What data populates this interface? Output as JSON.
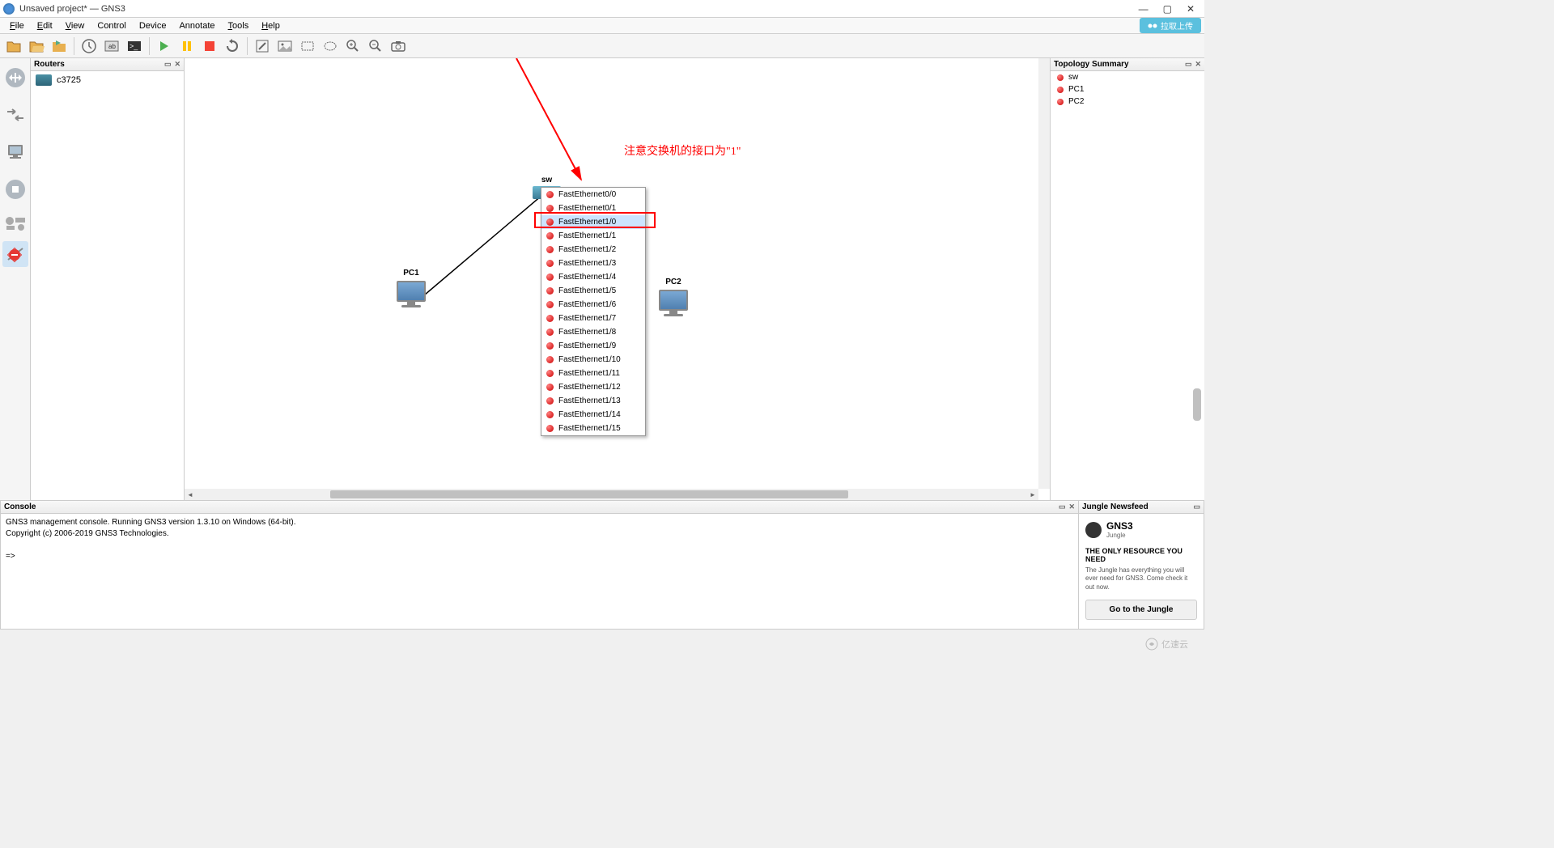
{
  "window": {
    "title": "Unsaved project* — GNS3"
  },
  "menu": {
    "file": "File",
    "edit": "Edit",
    "view": "View",
    "control": "Control",
    "device": "Device",
    "annotate": "Annotate",
    "tools": "Tools",
    "help": "Help",
    "right_badge": "拉取上传"
  },
  "panels": {
    "routers_title": "Routers",
    "routers_items": [
      "c3725"
    ],
    "topo_title": "Topology Summary",
    "topo_items": [
      "sw",
      "PC1",
      "PC2"
    ],
    "console_title": "Console",
    "newsfeed_title": "Jungle Newsfeed"
  },
  "canvas": {
    "sw_label": "sw",
    "pc1_label": "PC1",
    "pc2_label": "PC2",
    "annotation_text": "注意交换机的接口为\"1\""
  },
  "context_menu": {
    "items": [
      "FastEthernet0/0",
      "FastEthernet0/1",
      "FastEthernet1/0",
      "FastEthernet1/1",
      "FastEthernet1/2",
      "FastEthernet1/3",
      "FastEthernet1/4",
      "FastEthernet1/5",
      "FastEthernet1/6",
      "FastEthernet1/7",
      "FastEthernet1/8",
      "FastEthernet1/9",
      "FastEthernet1/10",
      "FastEthernet1/11",
      "FastEthernet1/12",
      "FastEthernet1/13",
      "FastEthernet1/14",
      "FastEthernet1/15"
    ],
    "highlighted_index": 2
  },
  "console": {
    "line1": "GNS3 management console. Running GNS3 version 1.3.10 on Windows (64-bit).",
    "line2": "Copyright (c) 2006-2019 GNS3 Technologies.",
    "prompt": "=>"
  },
  "newsfeed": {
    "logo_text": "GNS3",
    "logo_sub": "Jungle",
    "headline": "THE ONLY RESOURCE YOU NEED",
    "desc": "The Jungle has everything you will ever need for GNS3. Come check it out now.",
    "button": "Go to the Jungle"
  },
  "watermark": "亿速云"
}
